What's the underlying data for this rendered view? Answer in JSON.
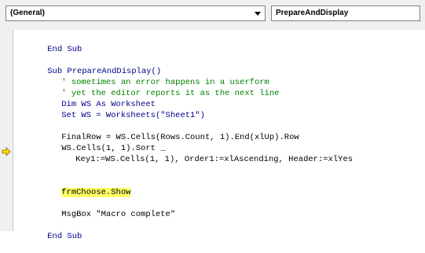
{
  "toolbar": {
    "object_combo": "(General)",
    "proc_combo": "PrepareAndDisplay"
  },
  "icons": {
    "dropdown": "chevron-down-icon",
    "execution_pointer": "arrow-right-icon"
  },
  "colors": {
    "keyword": "#00008b",
    "comment": "#008000",
    "highlight": "#ffff66",
    "execution_arrow": "#ffd700"
  },
  "code": {
    "line1": "End Sub",
    "line2": "Sub PrepareAndDisplay()",
    "line3": "' sometimes an error happens in a userform",
    "line4": "' yet the editor reports it as the next line",
    "line5": "Dim WS As Worksheet",
    "line6": "Set WS = Worksheets(\"Sheet1\")",
    "line7": "FinalRow = WS.Cells(Rows.Count, 1).End(xlUp).Row",
    "line8": "WS.Cells(1, 1).Sort _",
    "line9": "Key1:=WS.Cells(1, 1), Order1:=xlAscending, Header:=xlYes",
    "line10": "frmChoose.Show",
    "line11": "MsgBox \"Macro complete\"",
    "line12": "End Sub"
  }
}
